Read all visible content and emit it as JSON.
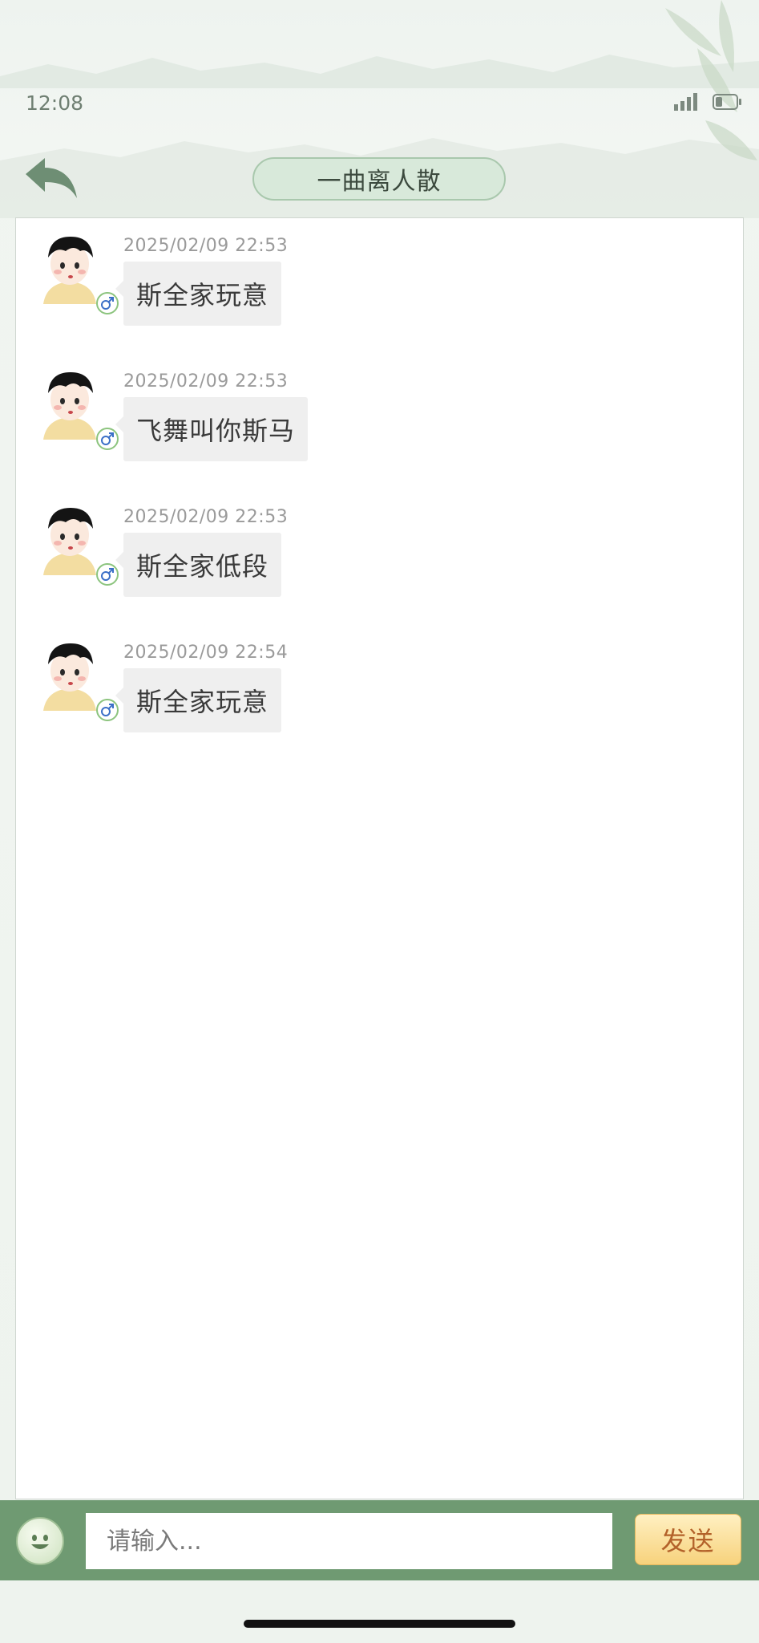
{
  "status_bar": {
    "time": "12:08"
  },
  "header": {
    "title": "一曲离人散"
  },
  "messages": [
    {
      "timestamp": "2025/02/09 22:53",
      "text": "斯全家玩意"
    },
    {
      "timestamp": "2025/02/09 22:53",
      "text": "飞舞叫你斯马"
    },
    {
      "timestamp": "2025/02/09 22:53",
      "text": "斯全家低段"
    },
    {
      "timestamp": "2025/02/09 22:54",
      "text": "斯全家玩意"
    }
  ],
  "composer": {
    "placeholder": "请输入...",
    "send_label": "发送"
  },
  "colors": {
    "accent_green": "#6f9a72",
    "title_pill": "#d8e9da",
    "send_button": "#f7d27c",
    "bubble": "#efefef"
  },
  "icons": [
    "back-arrow-icon",
    "signal-icon",
    "battery-icon",
    "male-gender-icon",
    "emoji-icon"
  ]
}
